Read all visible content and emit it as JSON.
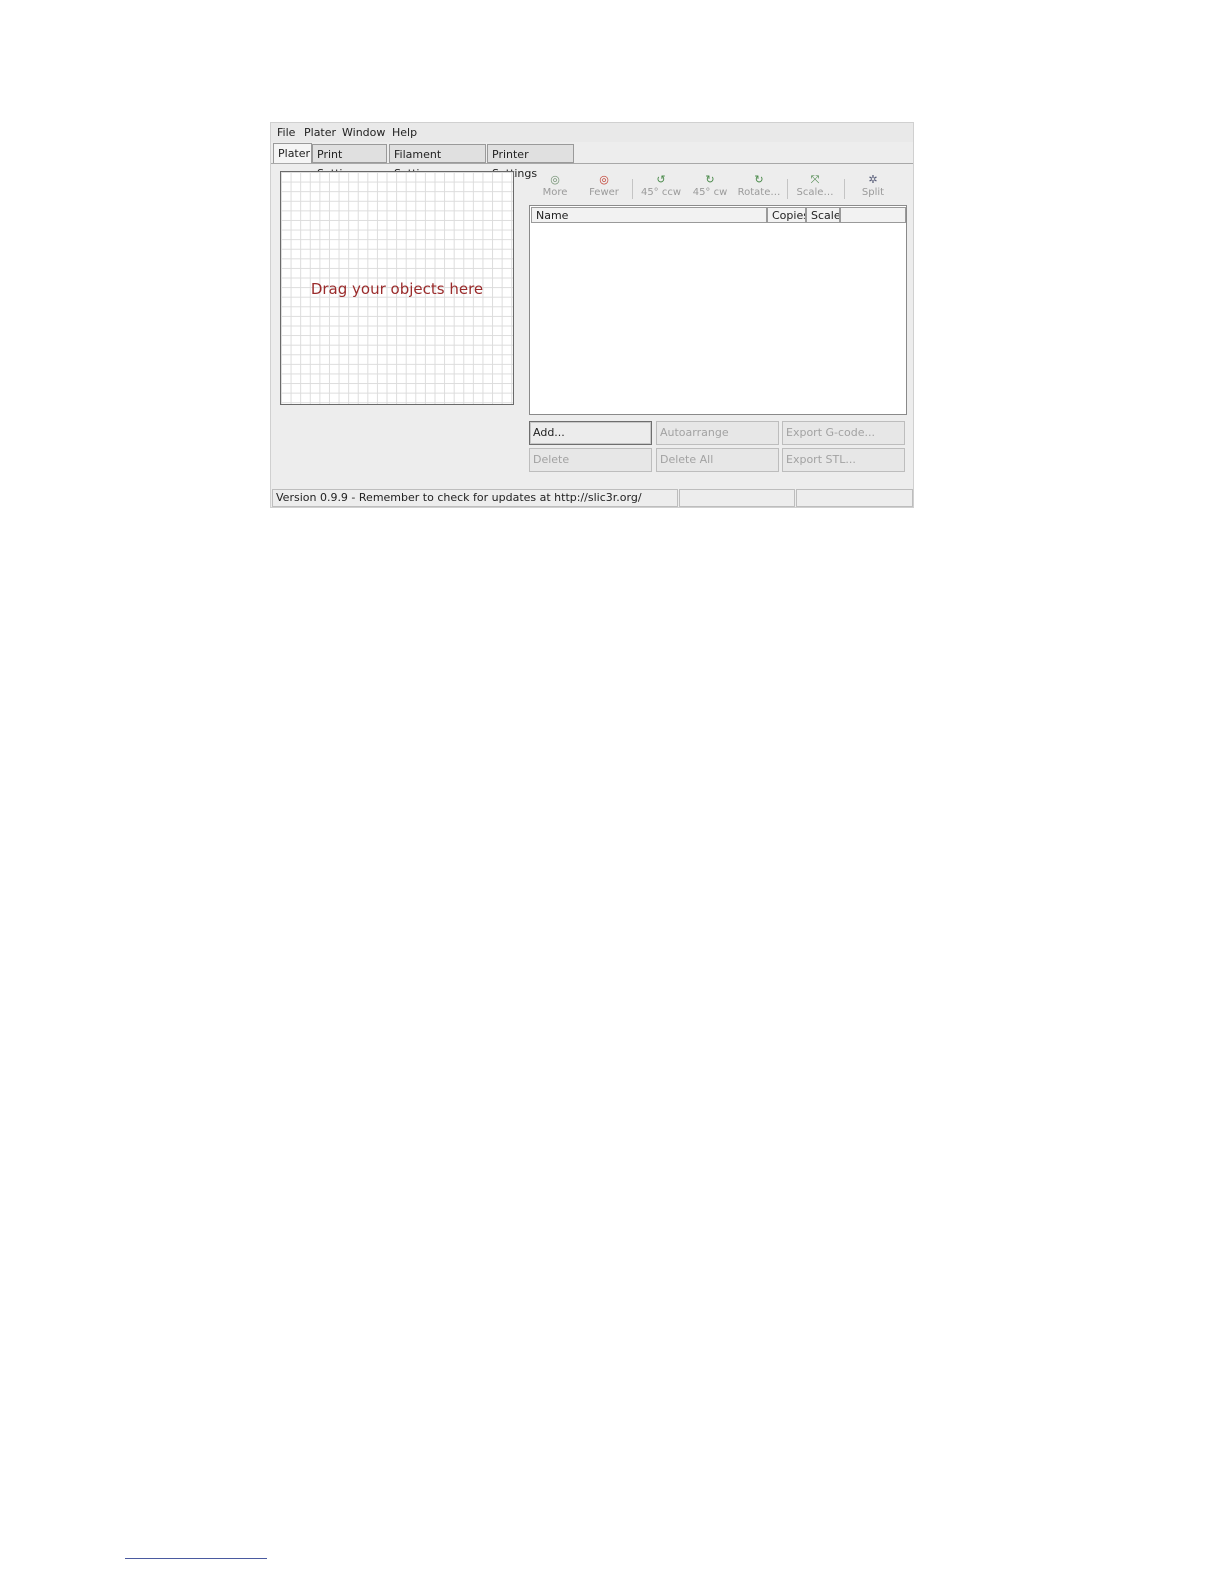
{
  "menu": [
    "File",
    "Plater",
    "Window",
    "Help"
  ],
  "tabs": [
    "Plater",
    "Print Settings",
    "Filament Settings",
    "Printer Settings"
  ],
  "canvas": {
    "hint": "Drag your objects here"
  },
  "toolbar": [
    {
      "label": "More",
      "icon": "◎"
    },
    {
      "label": "Fewer",
      "icon": "◎"
    },
    {
      "label": "45° ccw",
      "icon": "↺"
    },
    {
      "label": "45° cw",
      "icon": "↻"
    },
    {
      "label": "Rotate…",
      "icon": "↻"
    },
    {
      "label": "Scale…",
      "icon": "⤧"
    },
    {
      "label": "Split",
      "icon": "✲"
    }
  ],
  "object_list": {
    "columns": [
      "Name",
      "Copies",
      "Scale",
      ""
    ]
  },
  "buttons": {
    "add": "Add...",
    "autoarrange": "Autoarrange",
    "export_gcode": "Export G-code...",
    "delete": "Delete",
    "delete_all": "Delete All",
    "export_stl": "Export STL..."
  },
  "status": {
    "message": "Version 0.9.9 - Remember to check for updates at http://slic3r.org/"
  }
}
